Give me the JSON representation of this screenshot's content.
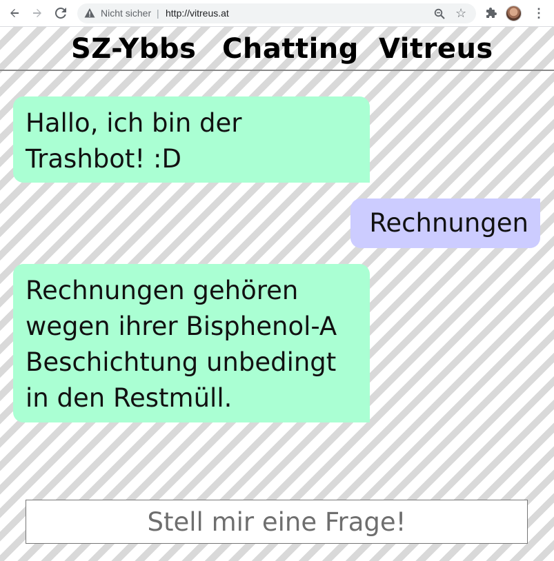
{
  "browser": {
    "security_label": "Nicht sicher",
    "separator": "|",
    "url": "http://vitreus.at"
  },
  "header": {
    "titles": [
      "SZ-Ybbs",
      "Chatting",
      "Vitreus"
    ]
  },
  "chat": {
    "messages": [
      {
        "sender": "bot",
        "text": "Hallo, ich bin der Trashbot! :D"
      },
      {
        "sender": "user",
        "text": "Rechnungen"
      },
      {
        "sender": "bot",
        "text": "Rechnungen gehören wegen ihrer Bisphenol-A Beschichtung unbedingt in den Restmüll."
      }
    ]
  },
  "input": {
    "placeholder": "Stell mir eine Frage!",
    "value": ""
  },
  "colors": {
    "bot_bubble": "#aaffd3",
    "user_bubble": "#ccccff",
    "stripe": "#d9d9d9"
  }
}
